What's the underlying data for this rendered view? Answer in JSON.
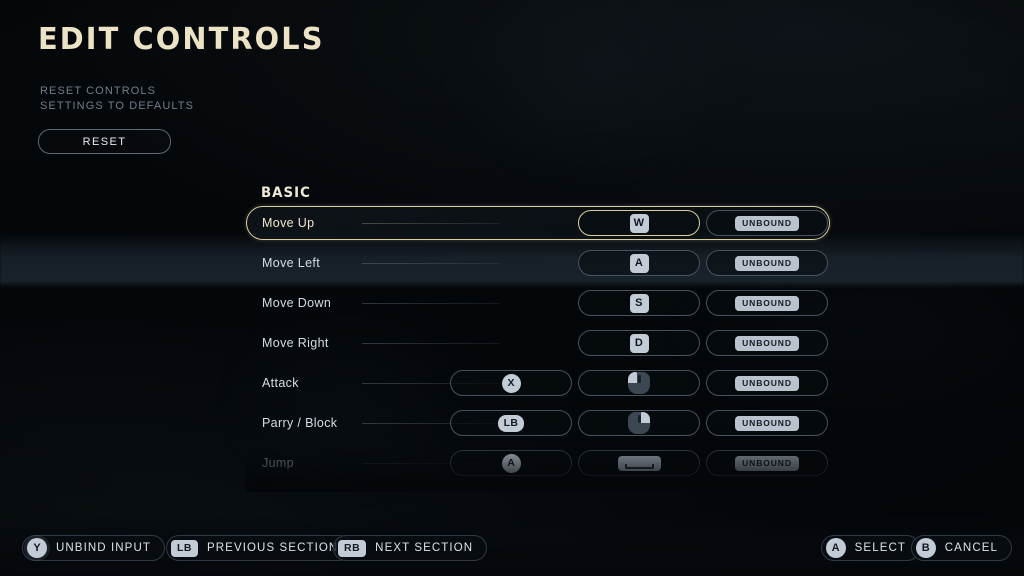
{
  "screen": {
    "title": "EDIT CONTROLS",
    "accent_color": "#d9cf9e",
    "background_color": "#040608"
  },
  "reset_panel": {
    "description_line1": "RESET CONTROLS",
    "description_line2": "SETTINGS TO DEFAULTS",
    "button_label": "RESET"
  },
  "section": {
    "label": "BASIC"
  },
  "columns": {
    "gamepad": "gamepad-binding",
    "keyboard": "keyboard-binding",
    "extra": "unbound-binding"
  },
  "bindings": [
    {
      "action": "Move Up",
      "selected": true,
      "dimmed": false,
      "gamepad": null,
      "keyboard": {
        "type": "keycap",
        "label": "W"
      },
      "extra": {
        "type": "chip",
        "label": "UNBOUND"
      }
    },
    {
      "action": "Move Left",
      "selected": false,
      "dimmed": false,
      "gamepad": null,
      "keyboard": {
        "type": "keycap",
        "label": "A"
      },
      "extra": {
        "type": "chip",
        "label": "UNBOUND"
      }
    },
    {
      "action": "Move Down",
      "selected": false,
      "dimmed": false,
      "gamepad": null,
      "keyboard": {
        "type": "keycap",
        "label": "S"
      },
      "extra": {
        "type": "chip",
        "label": "UNBOUND"
      }
    },
    {
      "action": "Move Right",
      "selected": false,
      "dimmed": false,
      "gamepad": null,
      "keyboard": {
        "type": "keycap",
        "label": "D"
      },
      "extra": {
        "type": "chip",
        "label": "UNBOUND"
      }
    },
    {
      "action": "Attack",
      "selected": false,
      "dimmed": false,
      "gamepad": {
        "type": "circle",
        "label": "X",
        "icon": "gamepad-x-button-icon"
      },
      "keyboard": {
        "type": "mouse",
        "button": "left",
        "icon": "mouse-left-click-icon"
      },
      "extra": {
        "type": "chip",
        "label": "UNBOUND"
      }
    },
    {
      "action": "Parry / Block",
      "selected": false,
      "dimmed": false,
      "gamepad": {
        "type": "pill",
        "label": "LB",
        "icon": "gamepad-lb-bumper-icon"
      },
      "keyboard": {
        "type": "mouse",
        "button": "right",
        "icon": "mouse-right-click-icon"
      },
      "extra": {
        "type": "chip",
        "label": "UNBOUND"
      }
    },
    {
      "action": "Jump",
      "selected": false,
      "dimmed": true,
      "gamepad": {
        "type": "circle",
        "label": "A",
        "icon": "gamepad-a-button-icon"
      },
      "keyboard": {
        "type": "spacebar",
        "label": "",
        "icon": "spacebar-key-icon"
      },
      "extra": {
        "type": "chip",
        "label": "UNBOUND"
      }
    }
  ],
  "footer": {
    "left_prompts": [
      {
        "glyph": "Y",
        "glyph_style": "circle",
        "label": "UNBIND INPUT",
        "icon": "gamepad-y-button-icon"
      },
      {
        "glyph": "LB",
        "glyph_style": "pill",
        "label": "PREVIOUS SECTION",
        "icon": "gamepad-lb-bumper-icon"
      },
      {
        "glyph": "RB",
        "glyph_style": "pill",
        "label": "NEXT SECTION",
        "icon": "gamepad-rb-bumper-icon"
      }
    ],
    "right_prompts": [
      {
        "glyph": "A",
        "glyph_style": "circle",
        "label": "SELECT",
        "icon": "gamepad-a-button-icon"
      },
      {
        "glyph": "B",
        "glyph_style": "circle",
        "label": "CANCEL",
        "icon": "gamepad-b-button-icon"
      }
    ]
  }
}
